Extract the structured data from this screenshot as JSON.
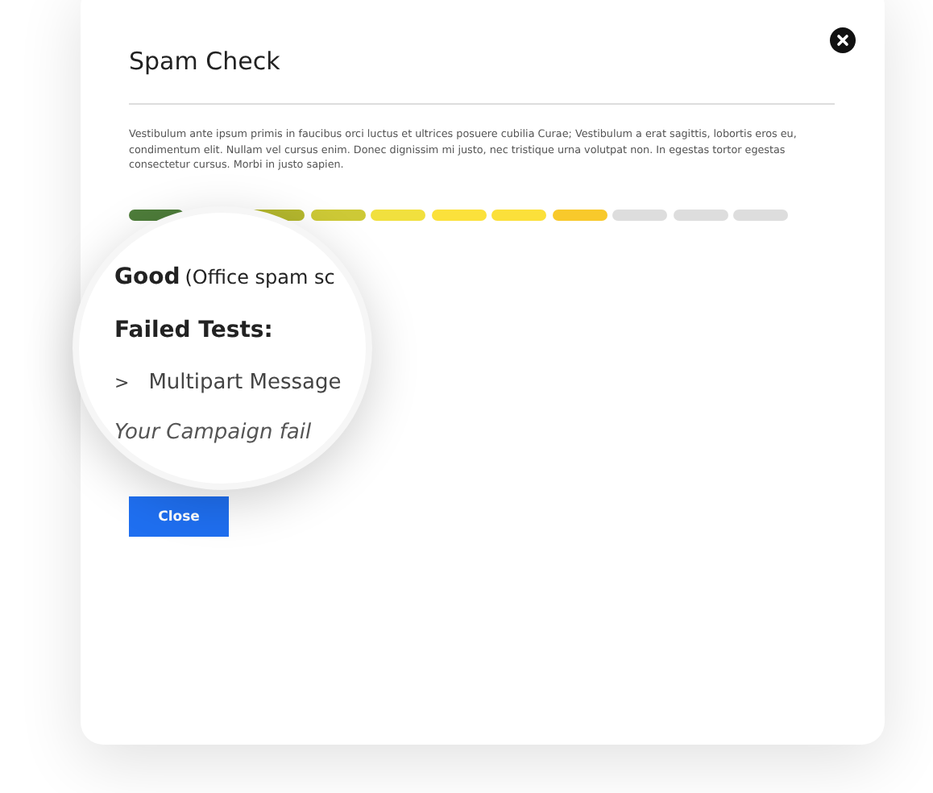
{
  "dialog": {
    "title": "Spam Check",
    "description": "Vestibulum ante ipsum primis in faucibus orci luctus et ultrices posuere cubilia Curae; Vestibulum a erat sagittis, lobortis eros eu, condimentum elit. Nullam vel cursus enim. Donec dignissim mi justo, nec tristique urna volutpat non. In egestas tortor egestas consectetur cursus. Morbi in justo sapien.",
    "score_segments": [
      {
        "color": "#4e7d3a"
      },
      {
        "color": "#b5b82e"
      },
      {
        "color": "#cdc936"
      },
      {
        "color": "#f1e03e"
      },
      {
        "color": "#fbe13b"
      },
      {
        "color": "#fbe03a"
      },
      {
        "color": "#f8c92b"
      },
      {
        "color": "#dddddd"
      },
      {
        "color": "#dddddd"
      },
      {
        "color": "#dddddd"
      }
    ],
    "magnifier": {
      "rating": "Good",
      "rating_note": "(Office spam sc",
      "failed_heading": "Failed Tests:",
      "failed_tests": [
        {
          "marker": ">",
          "name": "Multipart Message"
        }
      ],
      "message": "Your Campaign fail"
    },
    "close_button": "Close"
  }
}
